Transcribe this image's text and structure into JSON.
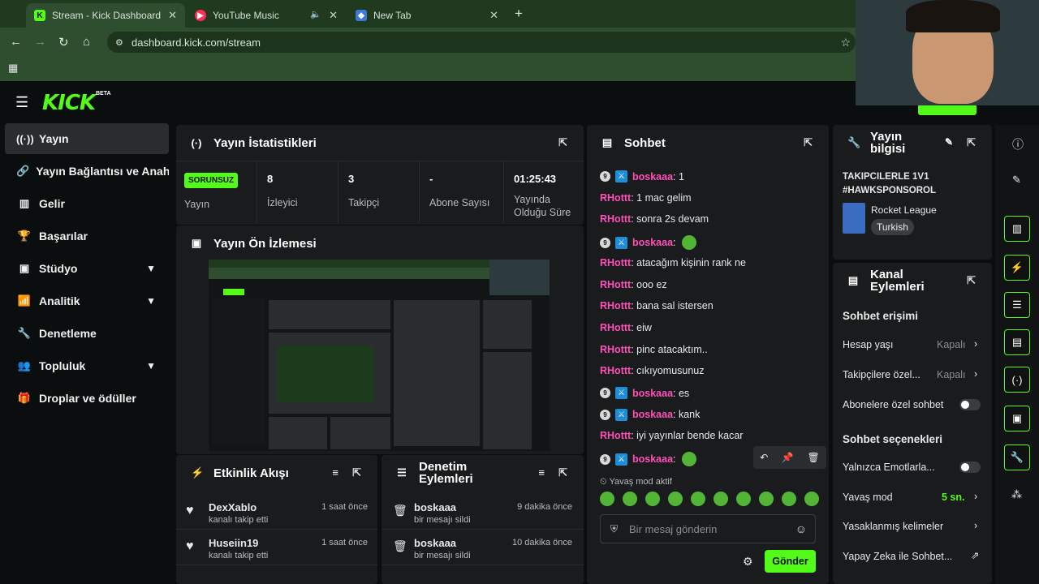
{
  "browser": {
    "tabs": [
      {
        "label": "Stream - Kick Dashboard"
      },
      {
        "label": "YouTube Music"
      },
      {
        "label": "New Tab"
      }
    ],
    "url": "dashboard.kick.com/stream"
  },
  "app": {
    "logo": "KICK",
    "beta": "BETA"
  },
  "sidebar": {
    "items": [
      {
        "label": "Yayın",
        "icon": "broadcast-icon"
      },
      {
        "label": "Yayın Bağlantısı ve Anahtarı",
        "icon": "link-icon"
      },
      {
        "label": "Gelir",
        "icon": "revenue-icon"
      },
      {
        "label": "Başarılar",
        "icon": "trophy-icon"
      },
      {
        "label": "Stüdyo",
        "icon": "studio-icon"
      },
      {
        "label": "Analitik",
        "icon": "analytics-icon"
      },
      {
        "label": "Denetleme",
        "icon": "wrench-icon"
      },
      {
        "label": "Topluluk",
        "icon": "community-icon"
      },
      {
        "label": "Droplar ve ödüller",
        "icon": "drops-icon"
      }
    ]
  },
  "stats": {
    "title": "Yayın İstatistikleri",
    "status_badge": "SORUNSUZ",
    "status_label": "Yayın",
    "viewers": "8",
    "viewers_label": "İzleyici",
    "followers": "3",
    "followers_label": "Takipçi",
    "subs": "-",
    "subs_label": "Abone Sayısı",
    "uptime": "01:25:43",
    "uptime_label": "Yayında Olduğu Süre"
  },
  "preview": {
    "title": "Yayın Ön İzlemesi"
  },
  "activity": {
    "title": "Etkinlik Akışı",
    "items": [
      {
        "user": "DexXablo",
        "action": "kanalı takip etti",
        "time": "1 saat önce"
      },
      {
        "user": "Huseiin19",
        "action": "kanalı takip etti",
        "time": "1 saat önce"
      }
    ]
  },
  "modactions": {
    "title": "Denetim Eylemleri",
    "items": [
      {
        "user": "boskaaa",
        "action": "bir mesajı sildi",
        "time": "9 dakika önce"
      },
      {
        "user": "boskaaa",
        "action": "bir mesajı sildi",
        "time": "10 dakika önce"
      }
    ]
  },
  "chat": {
    "title": "Sohbet",
    "messages": [
      {
        "user": "boskaaa",
        "text": "1",
        "badges": true
      },
      {
        "user": "RHottt",
        "text": "1 mac gelim"
      },
      {
        "user": "RHottt",
        "text": "sonra 2s devam"
      },
      {
        "user": "boskaaa",
        "text": "",
        "badges": true,
        "emote": true
      },
      {
        "user": "RHottt",
        "text": "atacağım kişinin rank ne"
      },
      {
        "user": "RHottt",
        "text": "ooo ez"
      },
      {
        "user": "RHottt",
        "text": "bana sal istersen"
      },
      {
        "user": "RHottt",
        "text": "eiw"
      },
      {
        "user": "RHottt",
        "text": "pinc atacaktım.."
      },
      {
        "user": "RHottt",
        "text": "cıkıyomusunuz"
      },
      {
        "user": "boskaaa",
        "text": "es",
        "badges": true
      },
      {
        "user": "boskaaa",
        "text": "kank",
        "badges": true
      },
      {
        "user": "RHottt",
        "text": "iyi yayınlar bende kacar"
      },
      {
        "user": "boskaaa",
        "text": "",
        "badges": true,
        "emote": true
      }
    ],
    "slow_mode": "Yavaş mod aktif",
    "input_placeholder": "Bir mesaj gönderin",
    "send": "Gönder"
  },
  "streaminfo": {
    "title": "Yayın bilgisi",
    "stream_title": "TAKIPCILERLE 1V1 #HAWKSPONSOROL",
    "category": "Rocket League",
    "language": "Turkish"
  },
  "channel": {
    "title": "Kanal Eylemleri",
    "chat_access": "Sohbet erişimi",
    "account_age": "Hesap yaşı",
    "account_age_val": "Kapalı",
    "followers_only": "Takipçilere özel...",
    "followers_only_val": "Kapalı",
    "subs_only": "Abonelere özel sohbet",
    "chat_options": "Sohbet seçenekleri",
    "emote_only": "Yalnızca Emotlarla...",
    "slow_mode": "Yavaş mod",
    "slow_mode_val": "5 sn.",
    "banned_words": "Yasaklanmış kelimeler",
    "ai": "Yapay Zeka ile Sohbet..."
  },
  "colors": {
    "accent": "#53fc18",
    "bg": "#0b0e0f",
    "panel": "#191b1d"
  }
}
